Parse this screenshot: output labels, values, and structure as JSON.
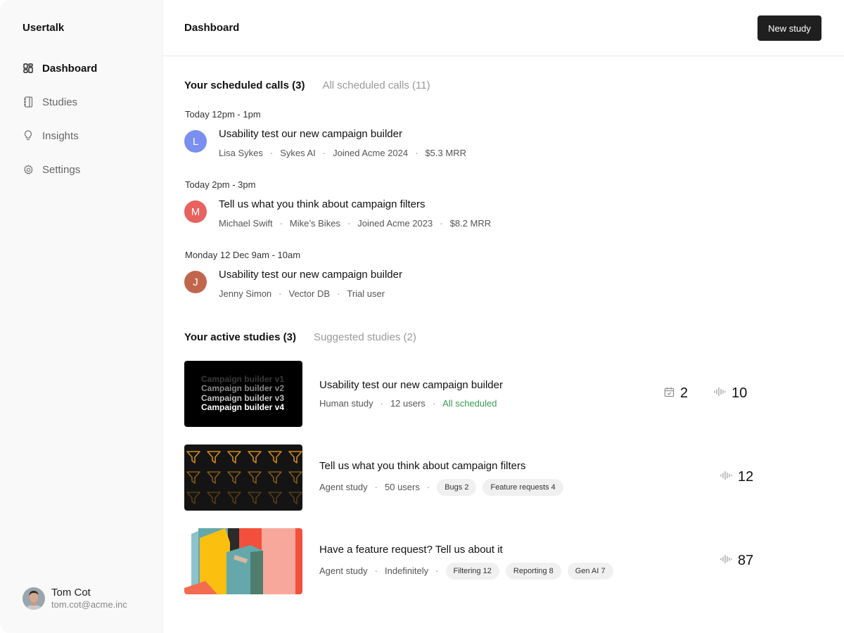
{
  "app": {
    "name": "Usertalk"
  },
  "sidebar": {
    "items": [
      {
        "label": "Dashboard",
        "icon": "dashboard-grid-icon",
        "active": true
      },
      {
        "label": "Studies",
        "icon": "notebook-icon",
        "active": false
      },
      {
        "label": "Insights",
        "icon": "lightbulb-icon",
        "active": false
      },
      {
        "label": "Settings",
        "icon": "gear-icon",
        "active": false
      }
    ],
    "user": {
      "name": "Tom Cot",
      "email": "tom.cot@acme.inc"
    }
  },
  "header": {
    "title": "Dashboard",
    "new_study_label": "New study"
  },
  "calls": {
    "tabs": [
      {
        "label": "Your scheduled calls (3)",
        "active": true
      },
      {
        "label": "All scheduled calls (11)",
        "active": false
      }
    ],
    "items": [
      {
        "time": "Today 12pm - 1pm",
        "initial": "L",
        "avatar_color": "#7b8ff0",
        "title": "Usability test our new campaign builder",
        "meta": [
          "Lisa Sykes",
          "Sykes AI",
          "Joined Acme 2024",
          "$5.3 MRR"
        ]
      },
      {
        "time": "Today 2pm - 3pm",
        "initial": "M",
        "avatar_color": "#e8625f",
        "title": "Tell us what you think about campaign filters",
        "meta": [
          "Michael Swift",
          "Mike’s Bikes",
          "Joined Acme 2023",
          "$8.2 MRR"
        ]
      },
      {
        "time": "Monday 12 Dec 9am - 10am",
        "initial": "J",
        "avatar_color": "#c0664d",
        "title": "Usability test our new campaign builder",
        "meta": [
          "Jenny Simon",
          "Vector DB",
          "Trial user"
        ]
      }
    ]
  },
  "studies": {
    "tabs": [
      {
        "label": "Your active studies (3)",
        "active": true
      },
      {
        "label": "Suggested studies (2)",
        "active": false
      }
    ],
    "items": [
      {
        "title": "Usability test our new campaign builder",
        "type": "Human study",
        "users": "12 users",
        "status": "All scheduled",
        "status_color": "#3a9a52",
        "thumb_lines": [
          "Campaign builder v1",
          "Campaign builder v2",
          "Campaign builder v3",
          "Campaign builder v4"
        ],
        "scheduled_count": "2",
        "recordings_count": "10"
      },
      {
        "title": "Tell us what you think about campaign filters",
        "type": "Agent study",
        "users": "50 users",
        "chips": [
          "Bugs 2",
          "Feature requests 4"
        ],
        "recordings_count": "12"
      },
      {
        "title": "Have a feature request? Tell us about it",
        "type": "Agent study",
        "users": "Indefinitely",
        "chips": [
          "Filtering 12",
          "Reporting 8",
          "Gen AI 7"
        ],
        "recordings_count": "87"
      }
    ]
  },
  "colors": {
    "accent_dark": "#1f1f1f",
    "success": "#3a9a52",
    "funnel": "#d08a1a"
  }
}
